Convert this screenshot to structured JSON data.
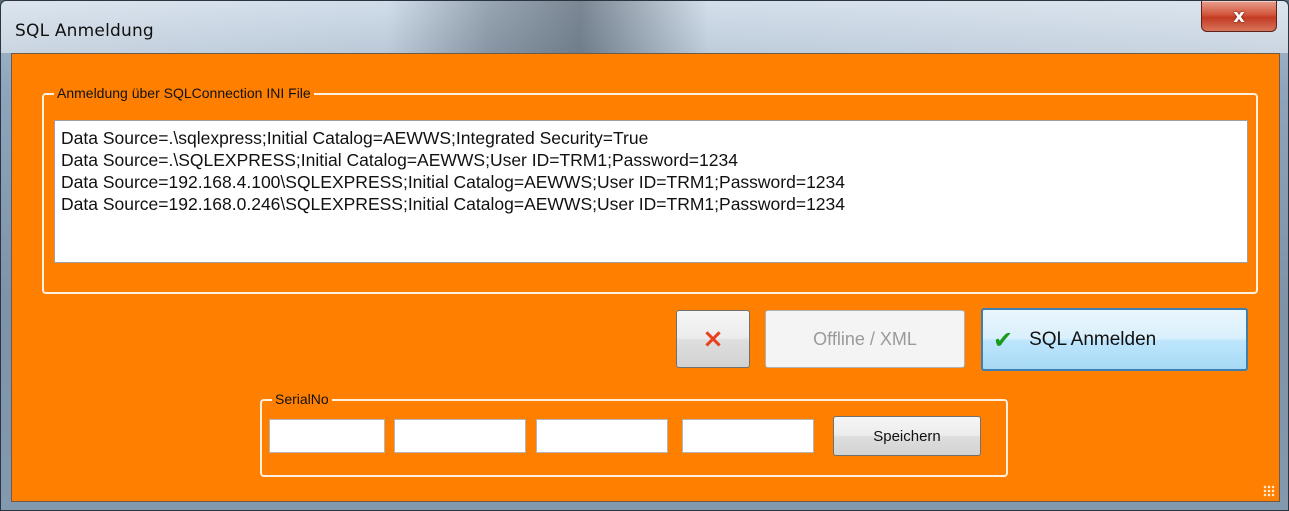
{
  "window": {
    "title": "SQL Anmeldung",
    "close_label": "x"
  },
  "ini_group": {
    "label": "Anmeldung über SQLConnection INI File",
    "connections": [
      "Data Source=.\\sqlexpress;Initial Catalog=AEWWS;Integrated Security=True",
      "Data Source=.\\SQLEXPRESS;Initial Catalog=AEWWS;User ID=TRM1;Password=1234",
      "Data Source=192.168.4.100\\SQLEXPRESS;Initial Catalog=AEWWS;User ID=TRM1;Password=1234",
      "Data Source=192.168.0.246\\SQLEXPRESS;Initial Catalog=AEWWS;User ID=TRM1;Password=1234"
    ]
  },
  "actions": {
    "cancel_icon": "×",
    "offline_label": "Offline / XML",
    "sql_login_label": "SQL Anmelden",
    "sql_login_icon": "✔"
  },
  "serial_group": {
    "label": "SerialNo",
    "fields": [
      "",
      "",
      "",
      ""
    ],
    "save_label": "Speichern"
  },
  "colors": {
    "client_background": "#ff8000",
    "cancel_icon": "#e8401c",
    "check_icon": "#1a9a1a"
  },
  "icons": {
    "close": "close-icon",
    "cancel": "cancel-x-icon",
    "check": "checkmark-icon",
    "grip": "resize-grip-icon"
  }
}
